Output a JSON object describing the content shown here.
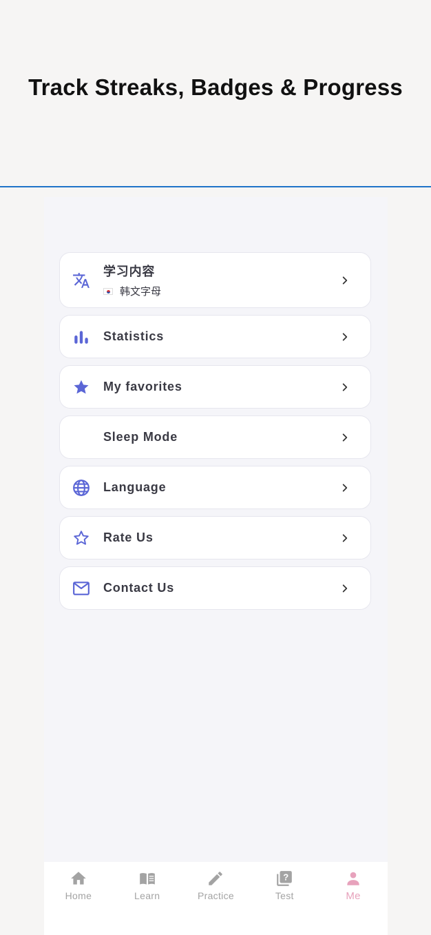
{
  "headline": "Track Streaks, Badges & Progress",
  "colors": {
    "accent": "#5b66d6",
    "divider": "#1e73c8",
    "tab_active": "#e7a2bc",
    "tab_inactive": "#a3a3a3"
  },
  "menu": {
    "items": [
      {
        "label": "学习内容",
        "sub": "韩文字母",
        "icon": "translate-icon"
      },
      {
        "label": "Statistics",
        "icon": "bar-chart-icon"
      },
      {
        "label": "My favorites",
        "icon": "star-filled-icon"
      },
      {
        "label": "Sleep Mode",
        "icon": "moon-icon"
      },
      {
        "label": "Language",
        "icon": "globe-icon"
      },
      {
        "label": "Rate Us",
        "icon": "star-outline-icon"
      },
      {
        "label": "Contact Us",
        "icon": "mail-icon"
      }
    ]
  },
  "tabbar": {
    "tabs": [
      {
        "label": "Home",
        "icon": "home-icon"
      },
      {
        "label": "Learn",
        "icon": "book-icon"
      },
      {
        "label": "Practice",
        "icon": "pencil-icon"
      },
      {
        "label": "Test",
        "icon": "quiz-icon"
      },
      {
        "label": "Me",
        "icon": "person-icon",
        "active": true
      }
    ]
  }
}
